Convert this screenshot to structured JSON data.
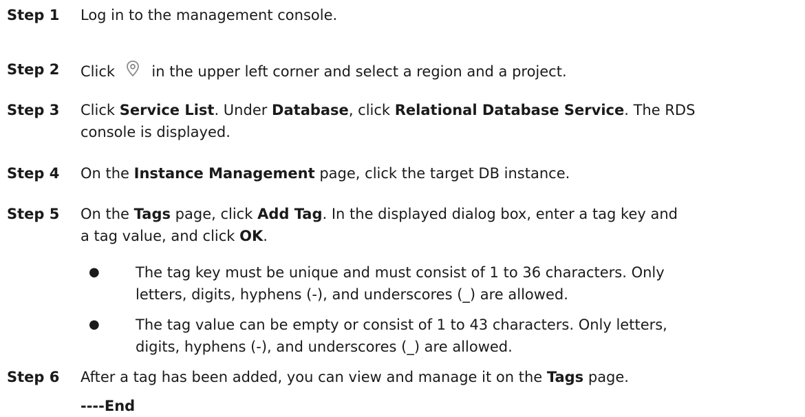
{
  "steps": [
    {
      "label": "Step 1",
      "text": "Log in to the management console."
    },
    {
      "label": "Step 2",
      "pre": "Click",
      "icon": "location-pin-icon",
      "post": "in the upper left corner and select a region and a project."
    },
    {
      "label": "Step 3",
      "t1": "Click ",
      "b1": "Service List",
      "t2": ". Under ",
      "b2": "Database",
      "t3": ", click ",
      "b3": "Relational Database Service",
      "t4": ". The RDS",
      "t5": "console is displayed."
    },
    {
      "label": "Step 4",
      "t1": "On the ",
      "b1": "Instance Management",
      "t2": " page, click the target DB instance."
    },
    {
      "label": "Step 5",
      "t1": "On the ",
      "b1": "Tags",
      "t2": " page, click ",
      "b2": "Add Tag",
      "t3": ". In the displayed dialog box, enter a tag key and",
      "t4": "a tag value, and click ",
      "b3": "OK",
      "t5": ".",
      "bullets": [
        {
          "line1": "The tag key must be unique and must consist of 1 to 36 characters. Only",
          "line2": "letters, digits, hyphens (-), and underscores (_) are allowed."
        },
        {
          "line1": "The tag value can be empty or consist of 1 to 43 characters. Only letters,",
          "line2": "digits, hyphens (-), and underscores (_) are allowed."
        }
      ]
    },
    {
      "label": "Step 6",
      "t1": "After a tag has been added, you can view and manage it on the ",
      "b1": "Tags",
      "t2": " page."
    }
  ],
  "end_marker": "----End"
}
